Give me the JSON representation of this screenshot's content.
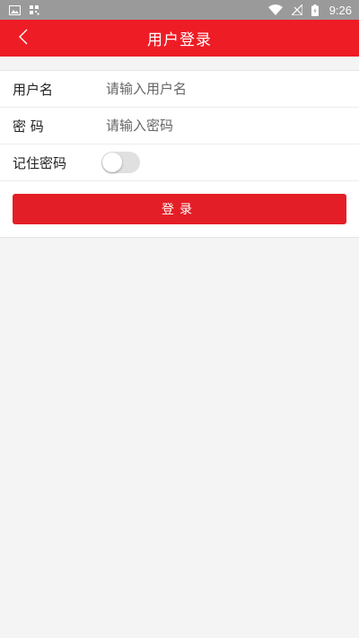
{
  "status_bar": {
    "time": "9:26",
    "icons": [
      "image-icon",
      "qr-grid-icon",
      "wifi-icon",
      "no-signal-icon",
      "battery-charging-icon"
    ]
  },
  "app_bar": {
    "title": "用户登录",
    "back_icon": "chevron-left-icon",
    "background": "#ee1c25"
  },
  "form": {
    "username": {
      "label": "用户名",
      "placeholder": "请输入用户名",
      "value": ""
    },
    "password": {
      "label": "密 码",
      "placeholder": "请输入密码",
      "value": ""
    },
    "remember": {
      "label": "记住密码",
      "checked": false
    }
  },
  "login_button": {
    "label": "登录",
    "color": "#e41e26"
  }
}
